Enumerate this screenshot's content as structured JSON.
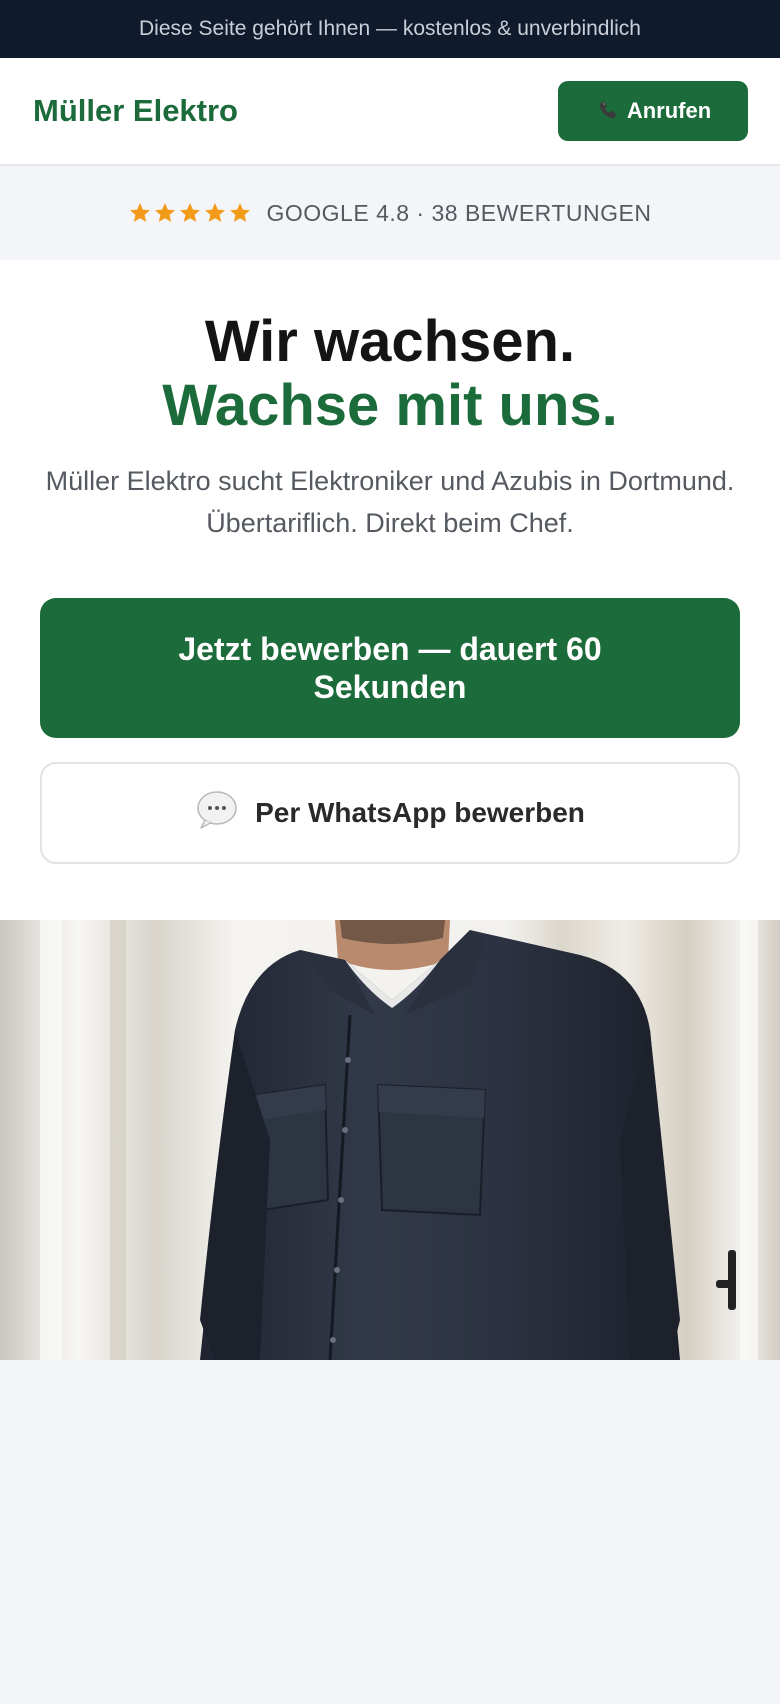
{
  "topbar": {
    "text": "Diese Seite gehört Ihnen — kostenlos & unverbindlich"
  },
  "header": {
    "brand": "Müller Elektro",
    "call_label": "Anrufen",
    "call_icon": "phone-icon"
  },
  "rating": {
    "stars": 5,
    "star_color": "#f29a1a",
    "text": "GOOGLE 4.8 · 38 BEWERTUNGEN"
  },
  "hero": {
    "headline_line1": "Wir wachsen.",
    "headline_line2": "Wachse mit uns.",
    "subline": "Müller Elektro sucht Elektroniker und Azubis in Dortmund. Übertariflich. Direkt beim Chef.",
    "apply_label": "Jetzt bewerben — dauert 60 Sekunden",
    "whatsapp_label": "Per WhatsApp bewerben",
    "whatsapp_icon": "speech-bubble-icon"
  },
  "colors": {
    "brand_green": "#1c6b3a",
    "topbar_bg": "#0f1b2d",
    "page_bg": "#f4f5f9"
  },
  "photo": {
    "icon": "worker-photo"
  }
}
